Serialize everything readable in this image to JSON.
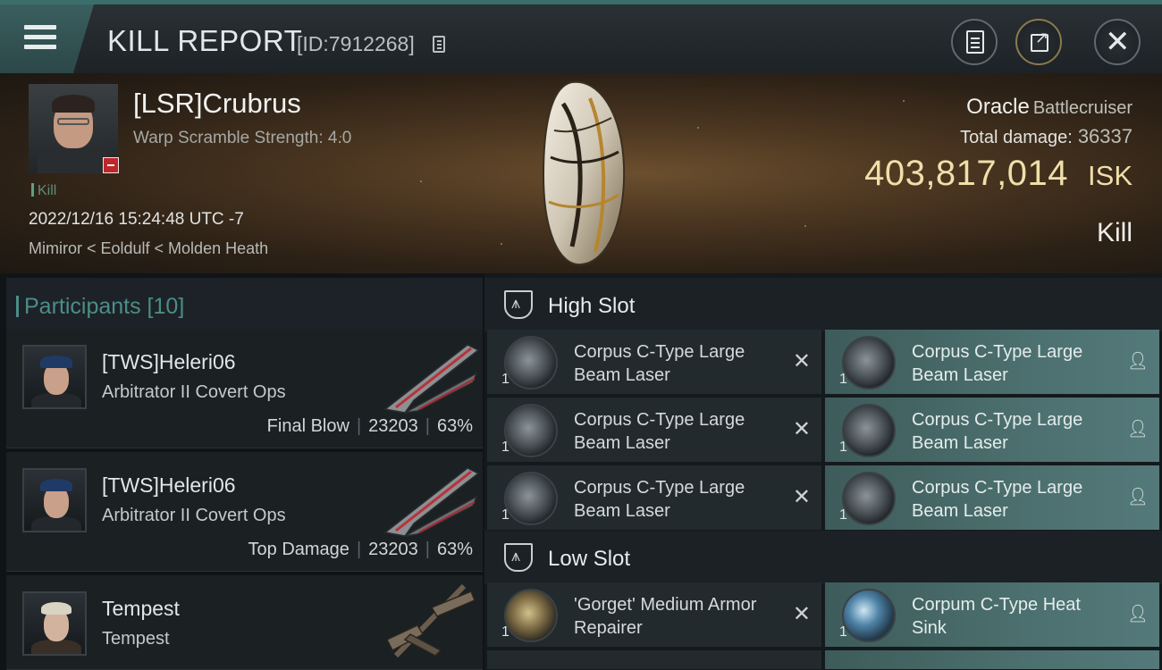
{
  "header": {
    "title": "KILL REPORT",
    "report_id": "[ID:7912268]"
  },
  "victim": {
    "name": "[LSR]Crubrus",
    "warp_scramble": "Warp Scramble Strength: 4.0",
    "tag": "Kill",
    "timestamp": "2022/12/16 15:24:48 UTC -7",
    "location": "Mimiror < Eoldulf < Molden Heath",
    "ship_name": "Oracle",
    "ship_class": "Battlecruiser",
    "damage_label": "Total damage:",
    "damage_value": "36337",
    "isk_value": "403,817,014",
    "isk_unit": "ISK",
    "result": "Kill"
  },
  "participants": {
    "title": "Participants [10]",
    "rows": [
      {
        "name": "[TWS]Heleri06",
        "ship": "Arbitrator II Covert Ops",
        "role": "Final Blow",
        "damage": "23203",
        "percent": "63%"
      },
      {
        "name": "[TWS]Heleri06",
        "ship": "Arbitrator II Covert Ops",
        "role": "Top Damage",
        "damage": "23203",
        "percent": "63%"
      },
      {
        "name": "Tempest",
        "ship": "Tempest",
        "role": "",
        "damage": "",
        "percent": ""
      }
    ]
  },
  "fitting": {
    "high_slot": {
      "title": "High Slot",
      "modules": [
        {
          "name": "Corpus C-Type Large Beam Laser",
          "qty": "1",
          "status": "destroyed"
        },
        {
          "name": "Corpus C-Type Large Beam Laser",
          "qty": "1",
          "status": "dropped"
        },
        {
          "name": "Corpus C-Type Large Beam Laser",
          "qty": "1",
          "status": "destroyed"
        },
        {
          "name": "Corpus C-Type Large Beam Laser",
          "qty": "1",
          "status": "dropped"
        },
        {
          "name": "Corpus C-Type Large Beam Laser",
          "qty": "1",
          "status": "destroyed"
        },
        {
          "name": "Corpus C-Type Large Beam Laser",
          "qty": "1",
          "status": "dropped"
        }
      ]
    },
    "low_slot": {
      "title": "Low Slot",
      "modules": [
        {
          "name": "'Gorget' Medium Armor Repairer",
          "qty": "1",
          "status": "destroyed"
        },
        {
          "name": "Corpum C-Type Heat Sink",
          "qty": "1",
          "status": "dropped"
        }
      ]
    }
  },
  "icons": {
    "menu": "menu-icon",
    "copy": "copy-icon",
    "clipboard": "clipboard-icon",
    "share": "share-icon",
    "close": "close-icon",
    "slot": "slot-icon",
    "destroyed": "x-icon",
    "dropped": "person-icon"
  },
  "colors": {
    "accent": "#4d8c88",
    "isk": "#f0dfa9",
    "dropped_bg": "#4c706f",
    "destroyed_bg": "#222a2e"
  }
}
